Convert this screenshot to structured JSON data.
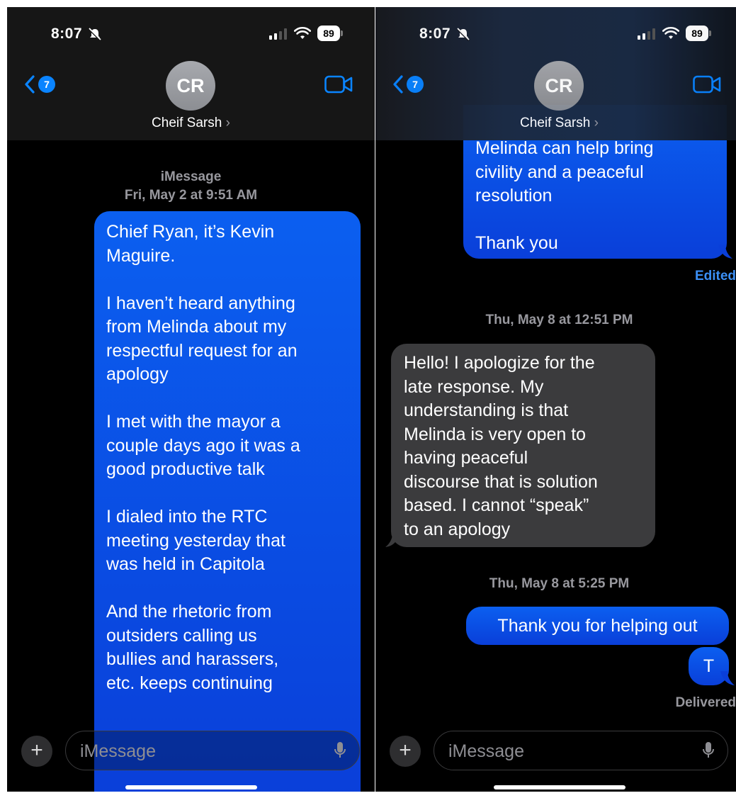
{
  "colors": {
    "accent": "#0a84ff",
    "sent_bubble": "#0a4ee6",
    "received_bubble": "#3b3b3d",
    "timestamp": "#98989e",
    "background": "#000000"
  },
  "left": {
    "status": {
      "time": "8:07",
      "battery": "89"
    },
    "header": {
      "back_badge": "7",
      "avatar_initials": "CR",
      "contact_name": "Cheif Sarsh",
      "contact_chevron": "›"
    },
    "thread": {
      "service_label": "iMessage",
      "timestamp": "Fri, May 2 at 9:51 AM",
      "message_lines": [
        "Chief Ryan,  it’s Kevin",
        "Maguire.",
        "",
        "I haven’t heard anything",
        "from Melinda about my",
        "respectful request for an",
        "apology",
        "",
        "I met with the mayor a",
        "couple days ago  it was a",
        "good productive talk",
        "",
        "I dialed into the RTC",
        "meeting yesterday that",
        "was held in Capitola",
        "",
        "And the rhetoric from",
        "outsiders calling us",
        "bullies and harassers,",
        "etc. keeps continuing"
      ]
    },
    "input": {
      "placeholder": "iMessage",
      "plus": "+"
    }
  },
  "right": {
    "status": {
      "time": "8:07",
      "battery": "89"
    },
    "header": {
      "back_badge": "7",
      "avatar_initials": "CR",
      "contact_name": "Cheif Sarsh",
      "contact_chevron": "›"
    },
    "thread": {
      "partial_lines": [
        "Melinda can help bring",
        "civility and a peaceful",
        "resolution",
        "",
        "Thank you"
      ],
      "edited_label": "Edited",
      "timestamp_1": "Thu, May 8 at 12:51 PM",
      "reply_lines": [
        "Hello! I apologize for the",
        "late response. My",
        "understanding is that",
        "Melinda is very open to",
        "having peaceful",
        "discourse that is solution",
        "based. I cannot “speak”",
        "to an apology"
      ],
      "timestamp_2": "Thu, May 8 at 5:25 PM",
      "sent_1": "Thank you for helping out",
      "sent_2": "T",
      "delivered_label": "Delivered"
    },
    "input": {
      "placeholder": "iMessage",
      "plus": "+"
    }
  }
}
